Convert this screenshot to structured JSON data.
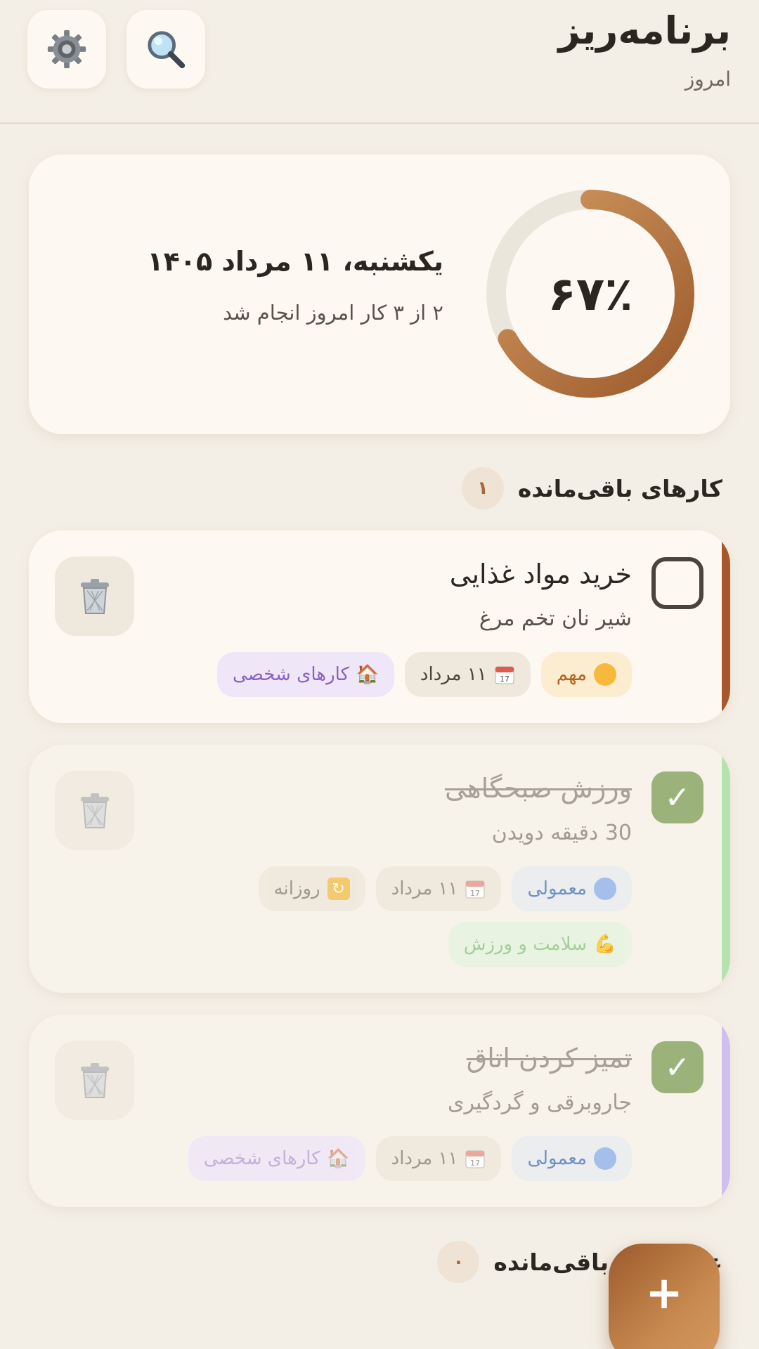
{
  "header": {
    "title": "برنامه‌ریز",
    "subtitle": "امروز",
    "search_icon": "search-icon",
    "settings_icon": "gear-icon"
  },
  "summary": {
    "date": "یکشنبه، ۱۱ مرداد ۱۴۰۵",
    "progress_text": "۲ از ۳ کار امروز انجام شد",
    "percent_text": "۶۷٪",
    "percent_value": 0.67,
    "ring_color_start": "#d39b62",
    "ring_color_end": "#9c5a2c",
    "ring_track_color": "#ebe6dc"
  },
  "sections": {
    "remaining_title": "کارهای باقی‌مانده",
    "remaining_count": "۱",
    "second_title": "عادت‌های باقی‌مانده",
    "second_count": "۰"
  },
  "tasks": [
    {
      "title": "خرید مواد غذایی",
      "description": "شیر نان تخم مرغ",
      "done": false,
      "accent_color": "#a8572a",
      "tags": {
        "priority": "مهم",
        "date": "۱۱ مرداد",
        "category": "کارهای شخصی"
      }
    },
    {
      "title": "ورزش صبحگاهی",
      "description": "30 دقیقه دویدن",
      "done": true,
      "accent_color": "#b5e3b0",
      "tags": {
        "priority": "معمولی",
        "date": "۱۱ مرداد",
        "repeat": "روزانه",
        "category": "سلامت و ورزش"
      }
    },
    {
      "title": "تمیز کردن اتاق",
      "description": "جاروبرقی و گردگیری",
      "done": true,
      "accent_color": "#cdbff0",
      "tags": {
        "priority": "معمولی",
        "date": "۱۱ مرداد",
        "category": "کارهای شخصی"
      }
    }
  ],
  "fab_label": "+",
  "check_mark": "✓",
  "colors": {
    "background": "#f4efe6",
    "card": "#fdf9f2",
    "accent_brown": "#a8683a",
    "check_green": "#9bb37a"
  }
}
